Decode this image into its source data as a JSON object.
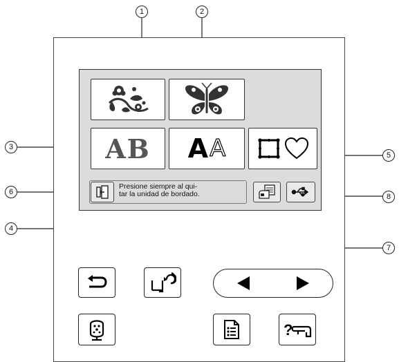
{
  "callouts": [
    "1",
    "2",
    "3",
    "4",
    "5",
    "6",
    "7",
    "8"
  ],
  "tiles": {
    "alphabet_preview": "AB",
    "font_preview_bold": "A",
    "font_preview_outline": "A"
  },
  "message": {
    "line1": "Presione siempre al qui-",
    "line2": "tar la unidad de bordado."
  },
  "hardware_icons": [
    "back-icon",
    "presser-foot-lift-icon",
    "prev-icon",
    "next-icon",
    "embroidery-hoop-icon",
    "checklist-icon",
    "help-icon"
  ]
}
